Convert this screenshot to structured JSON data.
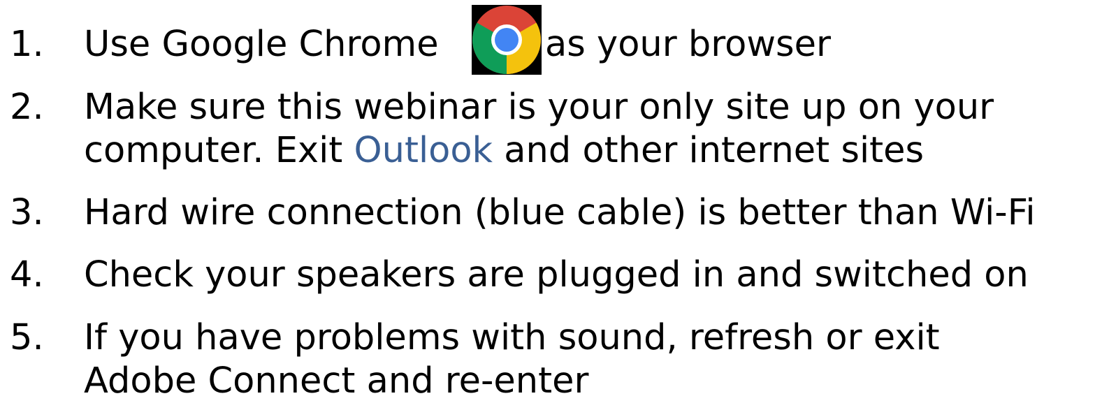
{
  "items": [
    {
      "number": "1.",
      "before_icon": "Use Google Chrome",
      "icon": "chrome-icon",
      "after_icon": "as your browser"
    },
    {
      "number": "2.",
      "line1": "Make sure this webinar is your only site up on your",
      "line2_before": "computer.  Exit",
      "line2_link": "Outlook",
      "line2_after": "and other internet sites"
    },
    {
      "number": "3.",
      "line1": "Hard wire connection (blue cable) is better than Wi-Fi"
    },
    {
      "number": "4.",
      "line1": "Check your speakers are plugged in and switched on"
    },
    {
      "number": "5.",
      "line1": "If you have problems with sound, refresh or exit",
      "line2": "Adobe Connect and re-enter"
    }
  ],
  "colors": {
    "text": "#000000",
    "link": "#3a5f94",
    "chrome_red": "#db4437",
    "chrome_yellow": "#f4c20d",
    "chrome_green": "#0f9d58",
    "chrome_blue": "#4285f4"
  }
}
